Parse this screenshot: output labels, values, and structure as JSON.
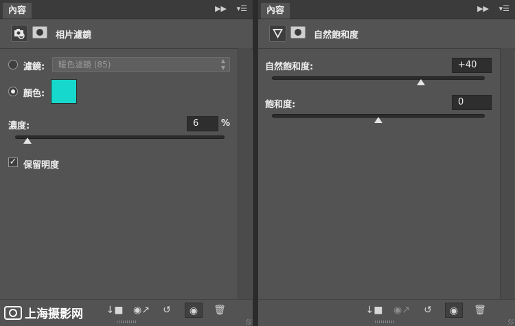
{
  "left": {
    "tab_label": "內容",
    "header_title": "相片濾鏡",
    "filter_label": "濾鏡:",
    "filter_value": "暖色濾鏡 (85)",
    "color_label": "顏色:",
    "color_value": "#17d8cc",
    "density_label": "濃度:",
    "density_value": "6",
    "density_unit": "%",
    "density_level": 0.06,
    "preserve_label": "保留明度",
    "preserve_checked": true
  },
  "right": {
    "tab_label": "內容",
    "header_title": "自然飽和度",
    "vibrance_label": "自然飽和度:",
    "vibrance_value": "+40",
    "vibrance_fraction": 0.7,
    "saturation_label": "飽和度:",
    "saturation_value": "0",
    "saturation_fraction": 0.5
  },
  "watermark_text": "上海摄影网",
  "colors": {
    "panel": "#535353",
    "tabbar": "#3b3b3b",
    "swatch": "#17d8cc"
  },
  "icons": [
    "camera-adjustment-icon",
    "layer-mask-icon",
    "vibrance-adjustment-icon",
    "clip-to-layer-icon",
    "view-previous-state-icon",
    "reset-icon",
    "visibility-eye-icon",
    "trash-icon"
  ]
}
